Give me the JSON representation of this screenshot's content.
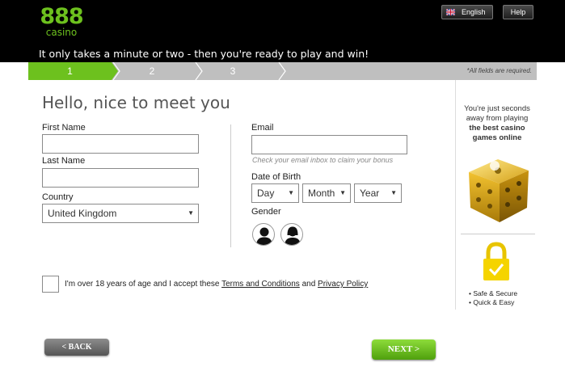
{
  "header": {
    "logo_number": "888",
    "logo_sub": "casino",
    "tagline": "It only takes a minute or two - then you're ready to play and win!",
    "language_label": "English",
    "help_label": "Help"
  },
  "steps": {
    "items": [
      "1",
      "2",
      "3"
    ],
    "active": "1",
    "required_note": "*All fields are required."
  },
  "form": {
    "title": "Hello, nice to meet you",
    "first_name_label": "First Name",
    "first_name_value": "",
    "last_name_label": "Last Name",
    "last_name_value": "",
    "country_label": "Country",
    "country_value": "United Kingdom",
    "email_label": "Email",
    "email_value": "",
    "email_hint": "Check your email inbox to claim your bonus",
    "dob_label": "Date of Birth",
    "dob_day": "Day",
    "dob_month": "Month",
    "dob_year": "Year",
    "gender_label": "Gender",
    "consent_prefix": "I'm over 18 years of age and I accept these",
    "terms_link": "Terms and Conditions",
    "consent_and": "and",
    "privacy_link": "Privacy Policy"
  },
  "buttons": {
    "back": "< BACK",
    "next": "NEXT >"
  },
  "sidebar": {
    "line1": "You're just seconds away from playing",
    "line2": "the best casino games online",
    "feature1": "• Safe & Secure",
    "feature2": "• Quick & Easy"
  },
  "colors": {
    "brand_green": "#6dc11e",
    "header_bg": "#000000",
    "step_inactive": "#bfbfbf"
  }
}
